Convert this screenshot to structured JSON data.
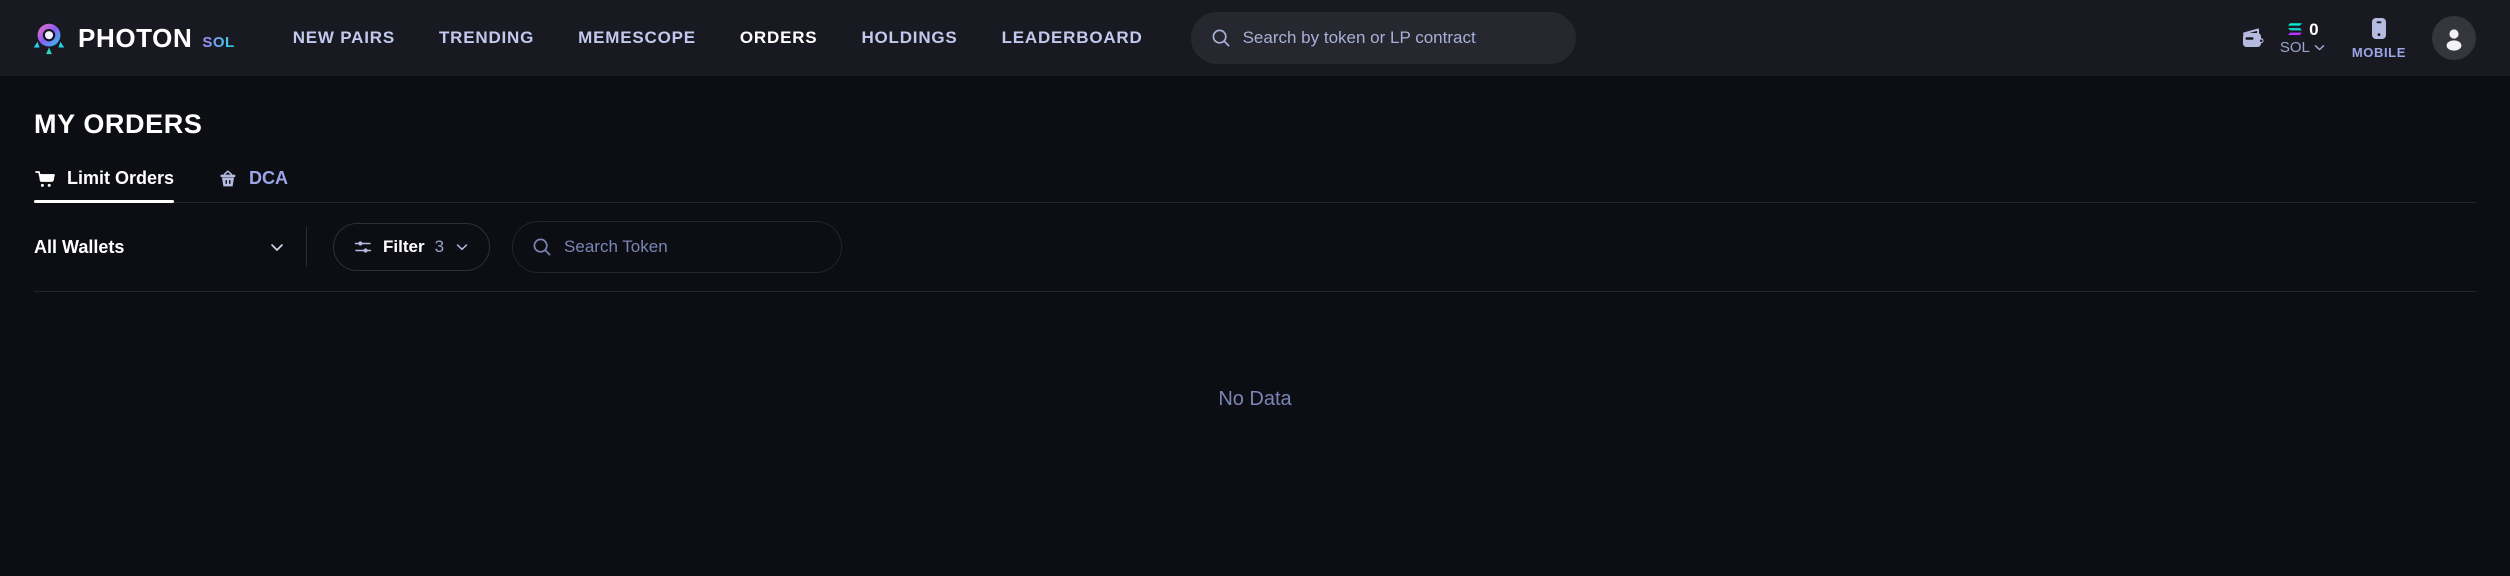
{
  "header": {
    "brand": {
      "name": "PHOTON",
      "chain": "SOL",
      "logo_icon": "photon-rocket-logo"
    },
    "nav": [
      {
        "label": "NEW PAIRS",
        "active": false
      },
      {
        "label": "TRENDING",
        "active": false
      },
      {
        "label": "MEMESCOPE",
        "active": false
      },
      {
        "label": "ORDERS",
        "active": true
      },
      {
        "label": "HOLDINGS",
        "active": false
      },
      {
        "label": "LEADERBOARD",
        "active": false
      }
    ],
    "search": {
      "placeholder": "Search by token or LP contract",
      "icon": "search-icon"
    },
    "wallet": {
      "icon": "wallet-icon",
      "balance": "0",
      "unit": "SOL",
      "unit_icon": "solana-icon",
      "chevron_icon": "chevron-down-icon"
    },
    "mobile": {
      "label": "MOBILE",
      "icon": "mobile-phone-icon"
    },
    "avatar": {
      "icon": "user-avatar-icon"
    }
  },
  "page": {
    "title": "MY ORDERS",
    "tabs": [
      {
        "label": "Limit Orders",
        "icon": "shopping-cart-icon",
        "active": true
      },
      {
        "label": "DCA",
        "icon": "basket-icon",
        "active": false
      }
    ],
    "filters": {
      "wallet_select": {
        "value": "All Wallets",
        "chevron_icon": "chevron-down-icon"
      },
      "filter_button": {
        "label": "Filter",
        "count": "3",
        "icon": "sliders-icon",
        "chevron_icon": "chevron-down-icon"
      },
      "token_search": {
        "placeholder": "Search Token",
        "icon": "search-icon"
      }
    },
    "empty_state": {
      "message": "No Data"
    }
  },
  "colors": {
    "header_bg": "#191a21",
    "page_bg": "#0d0e14",
    "nav_text": "#c3c8ee",
    "accent_white": "#ffffff",
    "muted": "#7b85b5",
    "divider": "#22242e"
  }
}
